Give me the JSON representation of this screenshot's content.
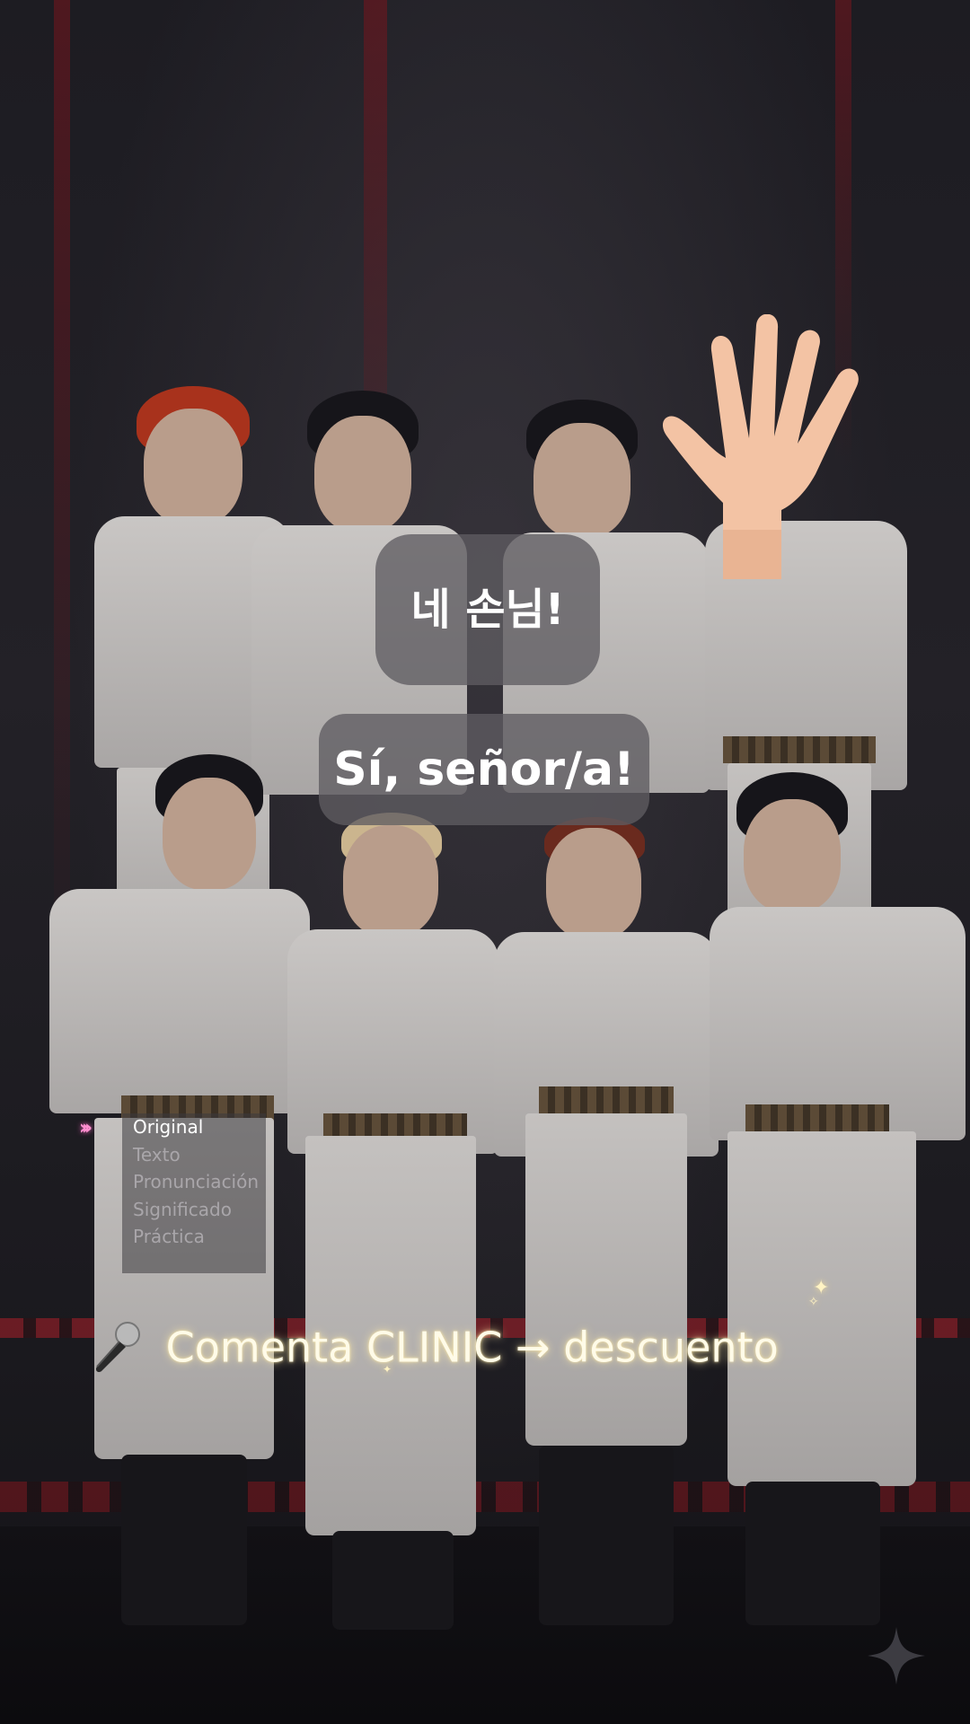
{
  "speech": {
    "korean": "네 손님!",
    "spanish": "Sí, señor/a!"
  },
  "steps_menu": {
    "items": [
      "Original",
      "Texto",
      "Pronunciación",
      "Significado",
      "Práctica"
    ],
    "active": "Original",
    "indicator_color": "#ff8fd0"
  },
  "cta": {
    "text": "Comenta CLINIC → descuento",
    "icon": "microphone-icon"
  },
  "icons": {
    "hand": "raised-hand-icon",
    "steps_indicator": "triple-chevron-icon",
    "corner": "four-point-star-icon"
  },
  "colors": {
    "bubble_bg": "#5f5c62",
    "text": "#ffffff",
    "cta_glow": "#ffeeaa"
  }
}
